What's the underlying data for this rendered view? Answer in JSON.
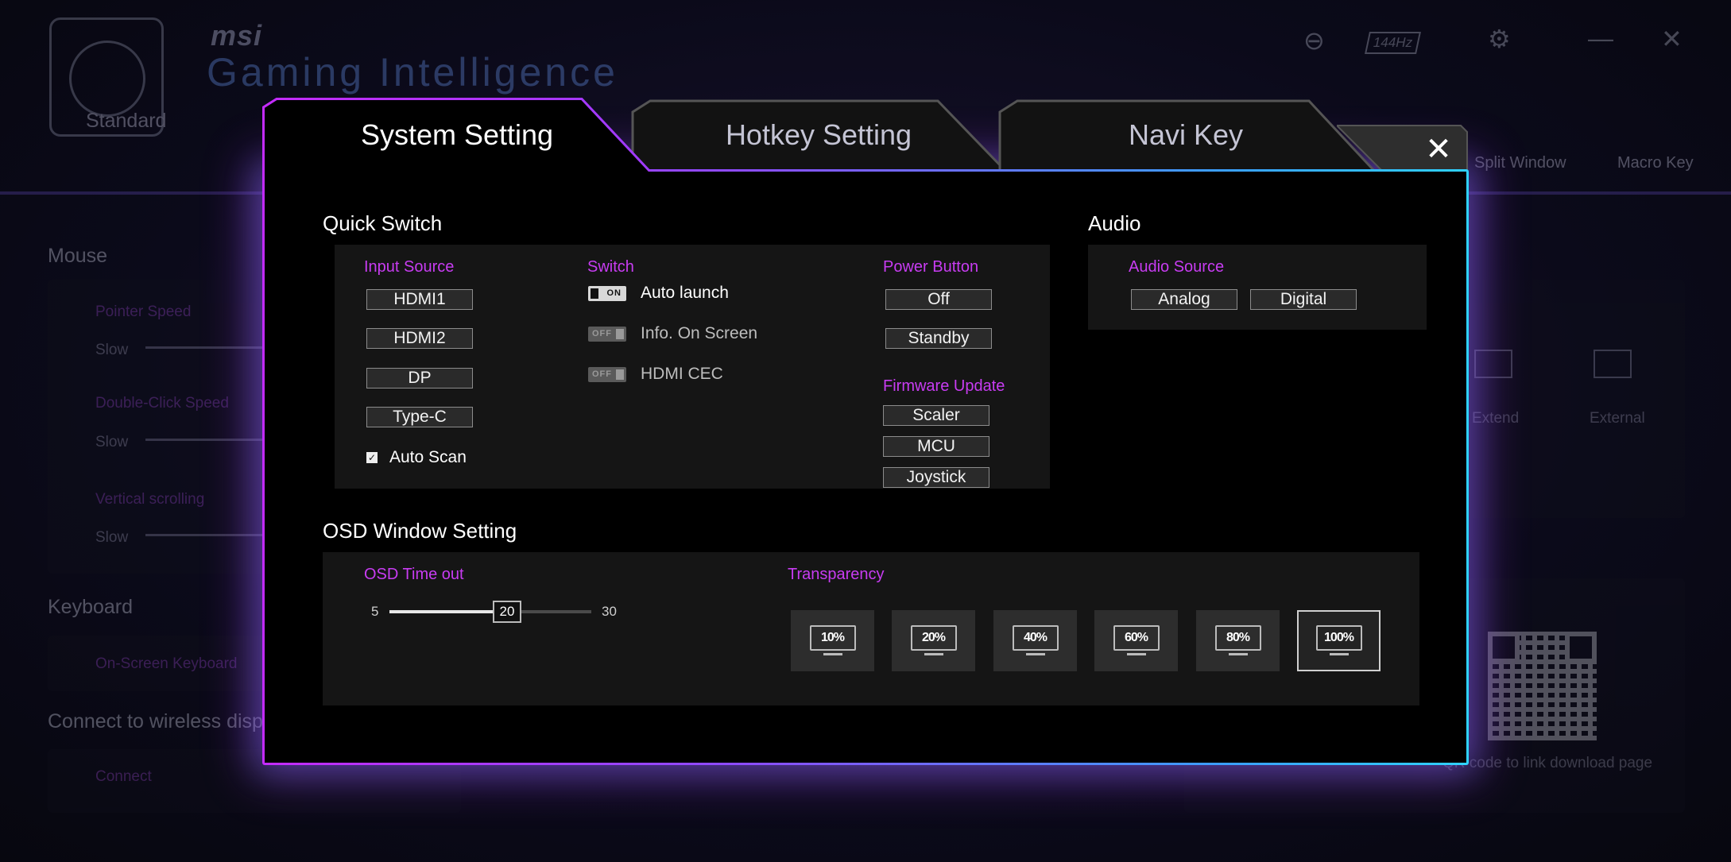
{
  "background": {
    "brand": "msi",
    "product": "Gaming Intelligence",
    "refresh_badge": "144Hz",
    "tabs": [
      "Standard",
      "Split Window",
      "Macro Key"
    ],
    "mouse_section": "Mouse",
    "pointer_speed": "Pointer Speed",
    "double_click": "Double-Click Speed",
    "vertical_scroll": "Vertical scrolling",
    "slow": "Slow",
    "keyboard_section": "Keyboard",
    "osk": "On-Screen Keyboard",
    "wireless_section": "Connect to wireless disp",
    "connect": "Connect",
    "extend": "Extend",
    "external": "External",
    "qr_text": "QR code to link download page"
  },
  "dialog": {
    "tabs": {
      "system": "System Setting",
      "hotkey": "Hotkey Setting",
      "navi": "Navi Key"
    },
    "close_icon": "close-icon",
    "quick_switch": {
      "title": "Quick Switch",
      "input_source": {
        "label": "Input Source",
        "options": [
          "HDMI1",
          "HDMI2",
          "DP",
          "Type-C"
        ],
        "auto_scan_label": "Auto Scan",
        "auto_scan_checked": true
      },
      "switch": {
        "label": "Switch",
        "on_text": "ON",
        "off_text": "OFF",
        "items": [
          {
            "label": "Auto launch",
            "state": "ON"
          },
          {
            "label": "Info. On Screen",
            "state": "OFF"
          },
          {
            "label": "HDMI CEC",
            "state": "OFF"
          }
        ]
      },
      "power_button": {
        "label": "Power Button",
        "options": [
          "Off",
          "Standby"
        ]
      },
      "firmware_update": {
        "label": "Firmware Update",
        "options": [
          "Scaler",
          "MCU",
          "Joystick"
        ]
      }
    },
    "audio": {
      "title": "Audio",
      "source_label": "Audio Source",
      "options": [
        "Analog",
        "Digital"
      ]
    },
    "osd": {
      "title": "OSD Window Setting",
      "timeout_label": "OSD Time out",
      "timeout_min": "5",
      "timeout_max": "30",
      "timeout_value": "20",
      "transparency_label": "Transparency",
      "transparency_options": [
        "10%",
        "20%",
        "40%",
        "60%",
        "80%",
        "100%"
      ],
      "transparency_selected": "100%"
    },
    "colors": {
      "accent_purple": "#c83cf2",
      "border_gradient_start": "#c42bff",
      "border_gradient_end": "#2fd2ff"
    }
  }
}
